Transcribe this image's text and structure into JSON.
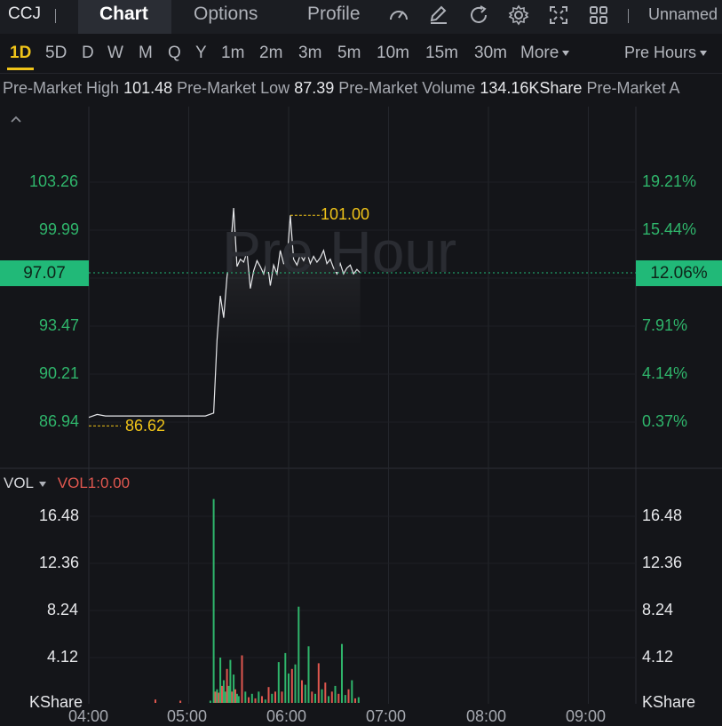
{
  "toolbar": {
    "ticker": "CCJ",
    "tabs": [
      "Chart",
      "Options",
      "Profile"
    ],
    "active_tab": "Chart",
    "icons": [
      "speedometer-icon",
      "pencil-icon",
      "refresh-icon",
      "gear-icon",
      "fullscreen-icon",
      "grid-icon"
    ],
    "layout_name": "Unnamed"
  },
  "periods": {
    "items": [
      "1D",
      "5D",
      "D",
      "W",
      "M",
      "Q",
      "Y",
      "1m",
      "2m",
      "3m",
      "5m",
      "10m",
      "15m",
      "30m"
    ],
    "active": "1D",
    "more_label": "More",
    "session_label": "Pre Hours"
  },
  "info": {
    "items": [
      {
        "label": "Pre-Market High",
        "value": "101.48"
      },
      {
        "label": "Pre-Market Low",
        "value": "87.39"
      },
      {
        "label": "Pre-Market Volume",
        "value": "134.16KShare"
      },
      {
        "label": "Pre-Market A",
        "value": ""
      }
    ]
  },
  "price_panel": {
    "watermark": "Pre Hour",
    "left_labels": [
      "103.26",
      "99.99",
      "93.47",
      "90.21",
      "86.94"
    ],
    "right_labels": [
      "19.21%",
      "15.44%",
      "7.91%",
      "4.14%",
      "0.37%"
    ],
    "current_price": "97.07",
    "current_pct": "12.06%",
    "high_annotation": "101.00",
    "low_annotation": "86.62",
    "collapse_icon": "chevron-up-icon"
  },
  "volume_panel": {
    "indicator": "VOL",
    "indicator_value": "VOL1:0.00",
    "left_labels": [
      "16.48",
      "12.36",
      "8.24",
      "4.12"
    ],
    "right_labels": [
      "16.48",
      "12.36",
      "8.24",
      "4.12"
    ],
    "unit_left": "KShare",
    "unit_right": "KShare"
  },
  "time_axis": [
    "04:00",
    "05:00",
    "06:00",
    "07:00",
    "08:00",
    "09:00"
  ],
  "colors": {
    "up": "#2fb56b",
    "down": "#e0574f",
    "accent": "#f0c419",
    "price_tag": "#21b978"
  },
  "chart_data": {
    "type": "line",
    "price_ylim": [
      86.0,
      104.0
    ],
    "price_series": {
      "times": [
        "04:00",
        "04:05",
        "04:10",
        "04:15",
        "04:20",
        "04:25",
        "04:30",
        "04:35",
        "04:40",
        "04:45",
        "04:50",
        "04:55",
        "05:00",
        "05:05",
        "05:10",
        "05:15",
        "05:17",
        "05:19",
        "05:21",
        "05:23",
        "05:25",
        "05:27",
        "05:29",
        "05:31",
        "05:33",
        "05:35",
        "05:37",
        "05:39",
        "05:41",
        "05:43",
        "05:45",
        "05:47",
        "05:49",
        "05:51",
        "05:53",
        "05:55",
        "05:57",
        "05:59",
        "06:01",
        "06:03",
        "06:05",
        "06:07",
        "06:09",
        "06:11",
        "06:13",
        "06:15",
        "06:17",
        "06:19",
        "06:21",
        "06:23",
        "06:25",
        "06:27",
        "06:29",
        "06:31",
        "06:33",
        "06:35",
        "06:37",
        "06:39",
        "06:41",
        "06:43"
      ],
      "values": [
        87.2,
        87.4,
        87.3,
        87.3,
        87.3,
        87.3,
        87.3,
        87.3,
        87.3,
        87.3,
        87.3,
        87.3,
        87.3,
        87.3,
        87.3,
        87.5,
        92.5,
        95.5,
        94.0,
        96.8,
        98.5,
        101.5,
        97.5,
        98.0,
        97.8,
        98.5,
        96.0,
        97.2,
        97.9,
        97.5,
        97.0,
        98.0,
        96.2,
        97.6,
        97.0,
        98.6,
        97.7,
        97.9,
        101.0,
        98.0,
        97.6,
        98.3,
        97.9,
        98.5,
        97.7,
        98.2,
        97.8,
        98.1,
        98.6,
        97.7,
        98.0,
        97.4,
        97.0,
        97.7,
        97.0,
        97.4,
        97.6,
        97.0,
        97.3,
        97.07
      ]
    },
    "volume_ylim": [
      0,
      20
    ],
    "volume_series": {
      "times": [
        "04:40",
        "04:55",
        "05:13",
        "05:15",
        "05:16",
        "05:17",
        "05:18",
        "05:19",
        "05:20",
        "05:21",
        "05:22",
        "05:23",
        "05:24",
        "05:25",
        "05:26",
        "05:27",
        "05:28",
        "05:29",
        "05:30",
        "05:32",
        "05:34",
        "05:36",
        "05:38",
        "05:40",
        "05:42",
        "05:44",
        "05:46",
        "05:48",
        "05:50",
        "05:52",
        "05:54",
        "05:56",
        "05:58",
        "06:00",
        "06:02",
        "06:04",
        "06:06",
        "06:08",
        "06:10",
        "06:12",
        "06:14",
        "06:16",
        "06:18",
        "06:20",
        "06:22",
        "06:24",
        "06:26",
        "06:28",
        "06:30",
        "06:32",
        "06:34",
        "06:36",
        "06:38",
        "06:40",
        "06:42"
      ],
      "values": [
        0.3,
        0.2,
        0.2,
        18.0,
        1.0,
        1.2,
        0.9,
        4.0,
        1.5,
        2.0,
        1.0,
        3.0,
        1.5,
        3.8,
        1.0,
        2.5,
        1.2,
        0.8,
        0.6,
        4.2,
        1.0,
        0.5,
        0.8,
        0.4,
        1.0,
        0.6,
        0.3,
        1.4,
        0.8,
        1.0,
        3.6,
        1.0,
        4.4,
        2.6,
        3.0,
        3.4,
        8.5,
        2.0,
        1.6,
        5.0,
        1.0,
        0.8,
        3.5,
        1.2,
        1.8,
        0.6,
        1.0,
        1.5,
        0.8,
        5.2,
        0.7,
        1.2,
        2.0,
        0.4,
        0.5
      ],
      "directions": [
        "down",
        "down",
        "up",
        "up",
        "down",
        "up",
        "down",
        "up",
        "down",
        "up",
        "up",
        "down",
        "up",
        "up",
        "down",
        "up",
        "down",
        "up",
        "up",
        "down",
        "up",
        "down",
        "up",
        "down",
        "up",
        "down",
        "up",
        "down",
        "up",
        "down",
        "up",
        "down",
        "up",
        "up",
        "down",
        "up",
        "up",
        "down",
        "up",
        "up",
        "down",
        "up",
        "down",
        "up",
        "down",
        "up",
        "down",
        "up",
        "down",
        "up",
        "up",
        "down",
        "up",
        "down",
        "up"
      ]
    }
  }
}
